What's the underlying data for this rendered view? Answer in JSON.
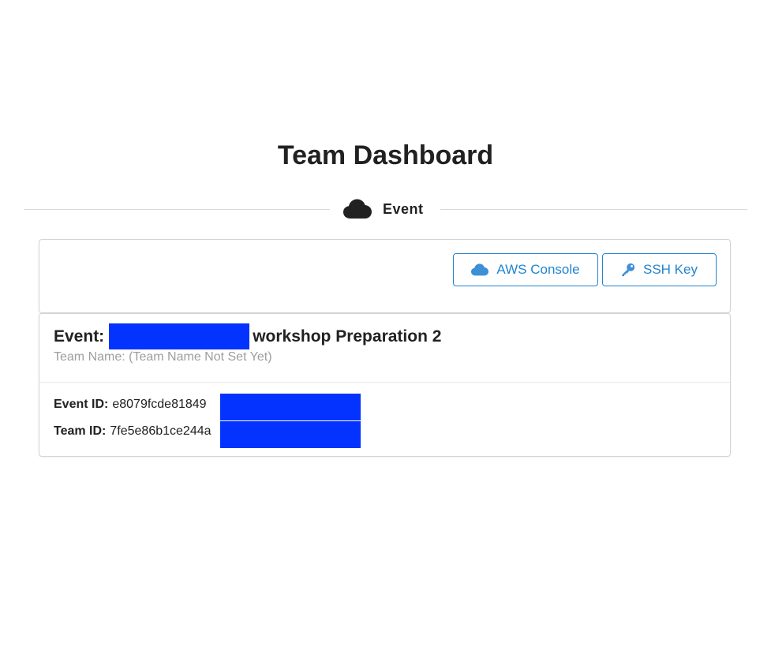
{
  "page": {
    "title": "Team Dashboard"
  },
  "section": {
    "label": "Event",
    "icon": "cloud-icon"
  },
  "actions": {
    "aws_console_label": "AWS Console",
    "aws_console_icon": "cloud-icon",
    "ssh_key_label": "SSH Key",
    "ssh_key_icon": "key-icon",
    "button_color": "#2185d0"
  },
  "event": {
    "title_prefix": "Event:",
    "title_suffix": "workshop Preparation 2",
    "team_name": "Team Name: (Team Name Not Set Yet)",
    "event_id_label": "Event ID:",
    "event_id_value": "e8079fcde81849",
    "team_id_label": "Team ID:",
    "team_id_value": "7fe5e86b1ce244a",
    "redaction_color": "#0433ff"
  }
}
